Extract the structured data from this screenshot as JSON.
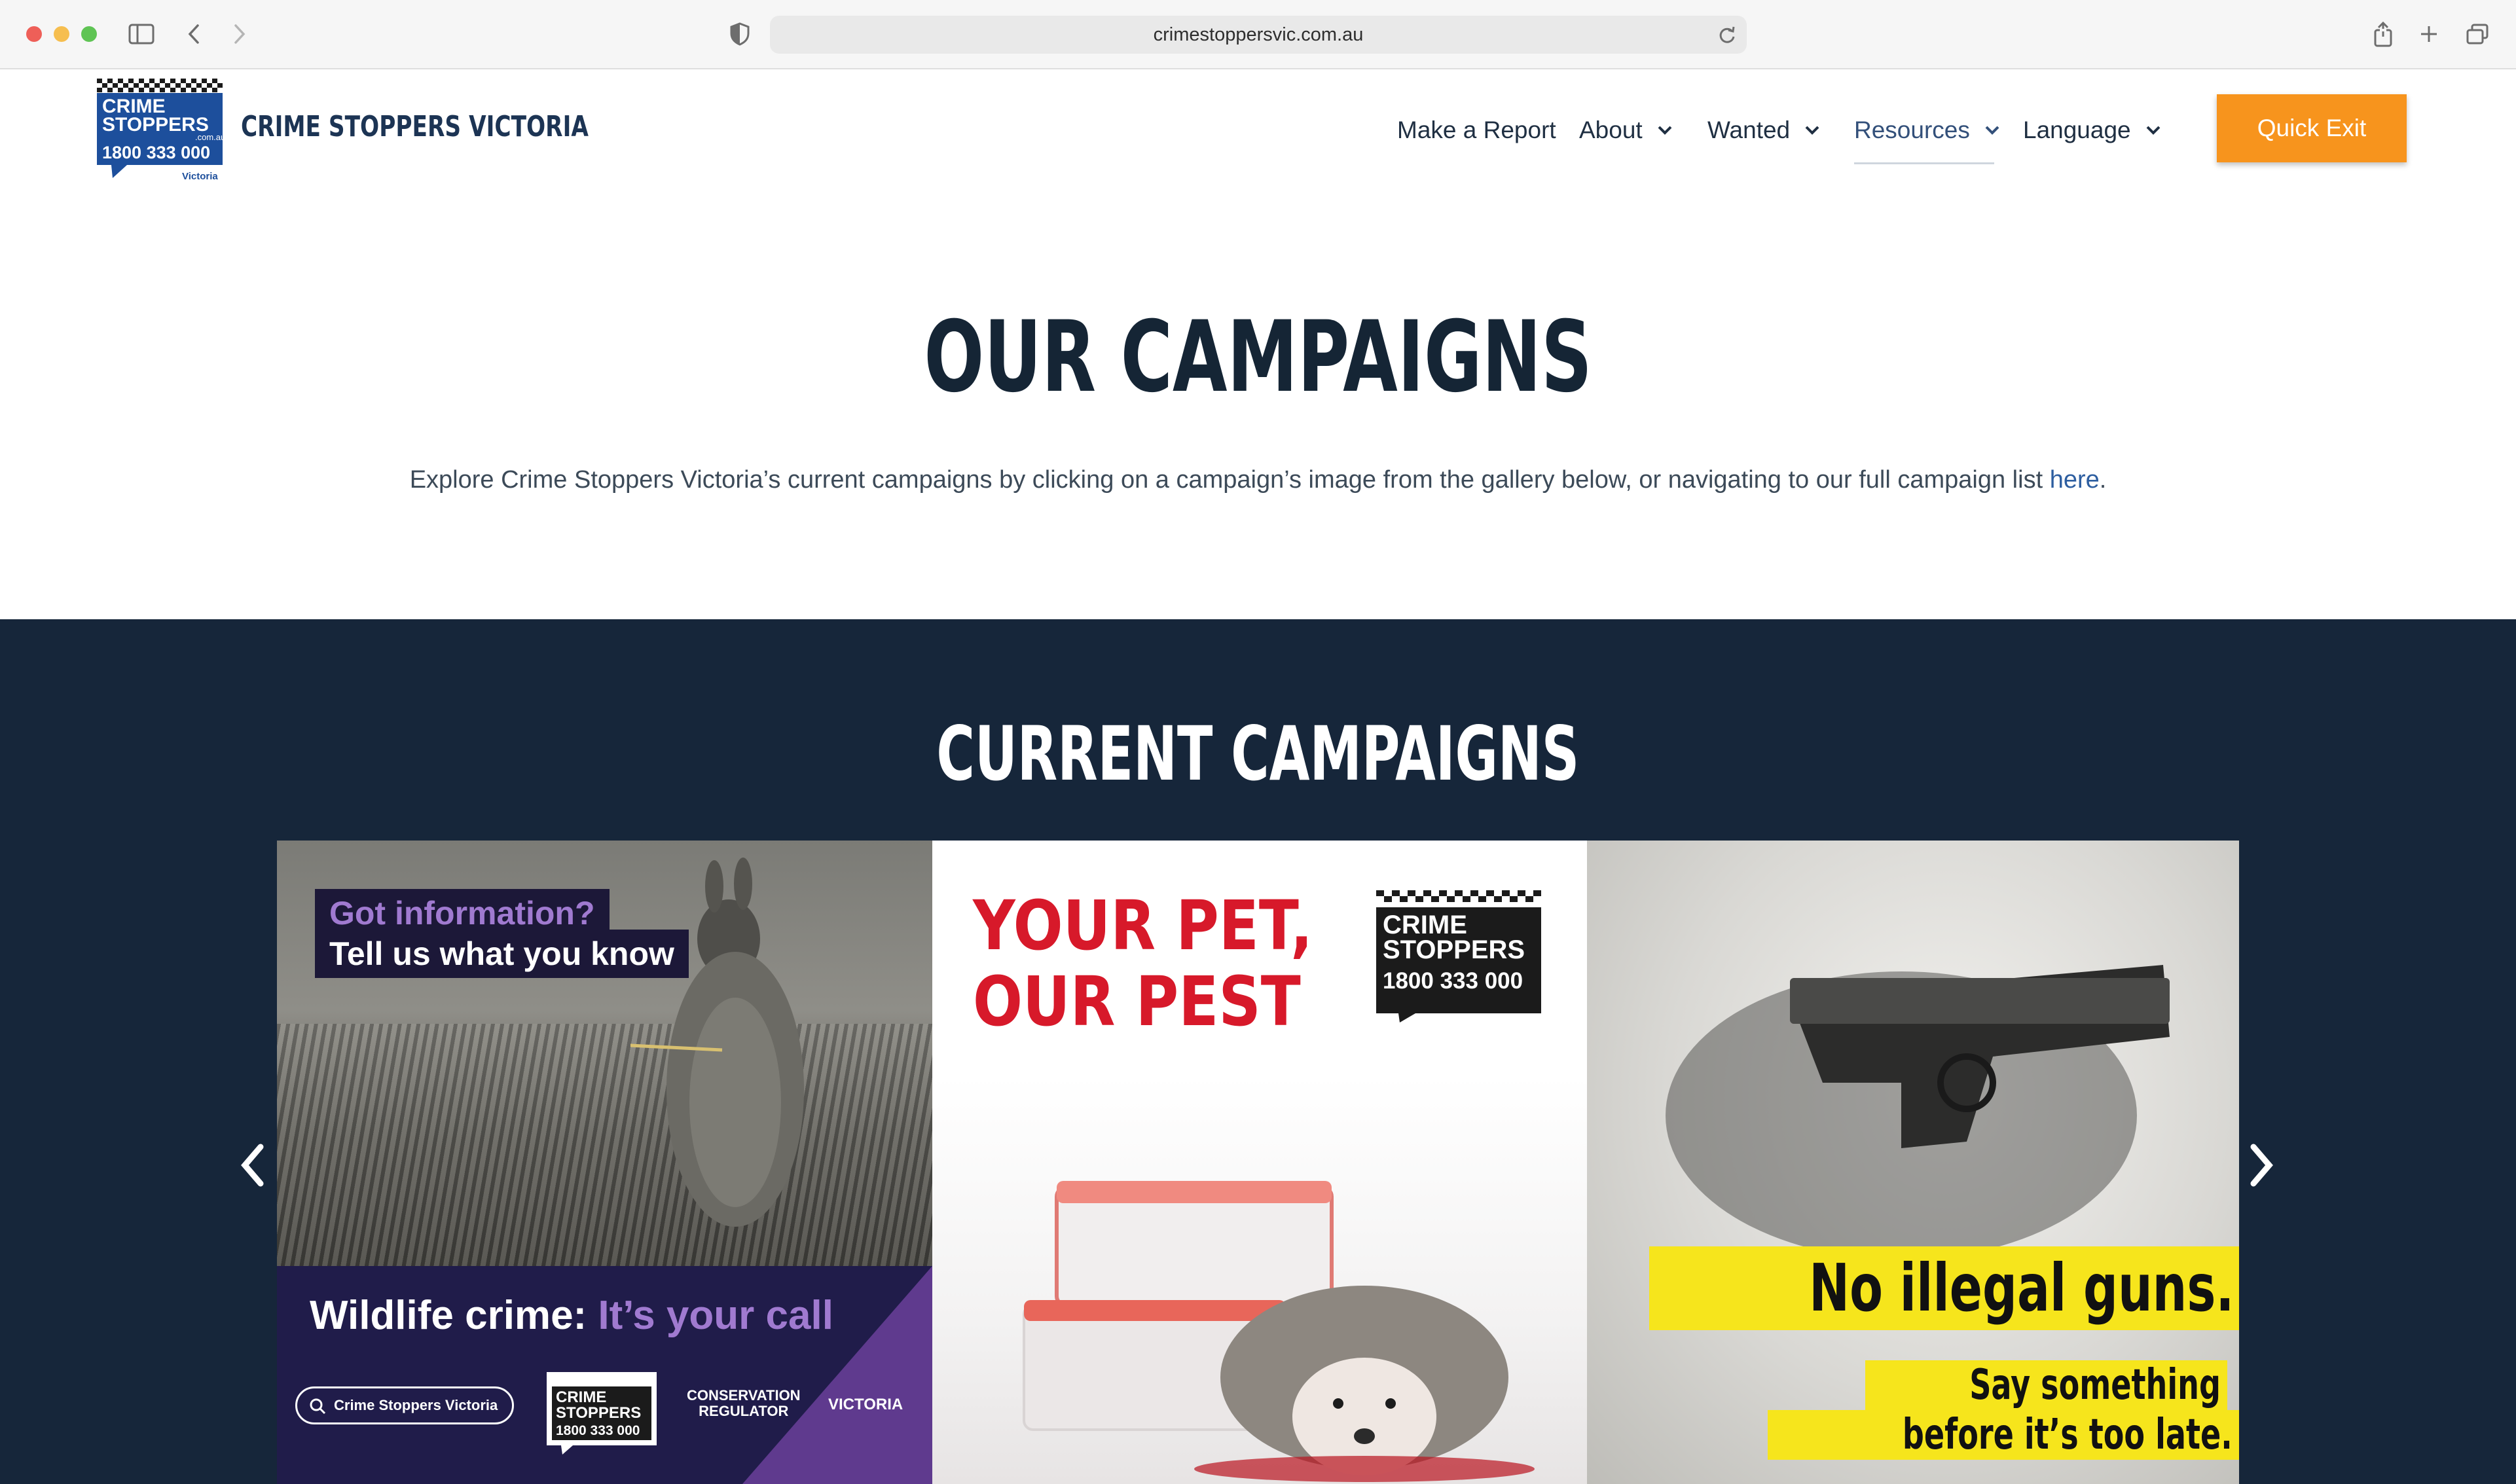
{
  "browser": {
    "url": "crimestoppersvic.com.au"
  },
  "header": {
    "logo_lines": [
      "CRIME",
      "STOPPERS",
      ".com.au",
      "1800 333 000",
      "Victoria"
    ],
    "brand_name": "CRIME STOPPERS VICTORIA",
    "nav": [
      {
        "label": "Make a Report"
      },
      {
        "label": "About"
      },
      {
        "label": "Wanted"
      },
      {
        "label": "Resources"
      },
      {
        "label": "Language"
      }
    ],
    "quick_exit": "Quick Exit"
  },
  "hero": {
    "title": "OUR CAMPAIGNS",
    "subtitle": "Explore Crime Stoppers Victoria’s current campaigns by clicking on a campaign’s image from the gallery below, or navigating to our full campaign list ",
    "link": "here",
    "subtitle_end": "."
  },
  "campaigns": {
    "title": "CURRENT CAMPAIGNS",
    "slides": [
      {
        "box1": "Got information?",
        "box2": "Tell us what you know",
        "headline": "Wildlife crime: ",
        "headline_accent": "It’s your call",
        "pill": "Crime Stoppers Victoria",
        "partner": [
          "CONSERVATION",
          "REGULATOR"
        ],
        "partner_state": "VICTORIA"
      },
      {
        "title_lines": [
          "YOUR PET,",
          "OUR PEST"
        ]
      },
      {
        "big": "No illegal guns.",
        "small1": "Say something",
        "small2": "before it’s too late."
      }
    ]
  },
  "colors": {
    "navy": "#16263a",
    "orange": "#f7941d",
    "link": "#2d5ea0",
    "yellow": "#f6e51c",
    "red": "#d7192a"
  }
}
